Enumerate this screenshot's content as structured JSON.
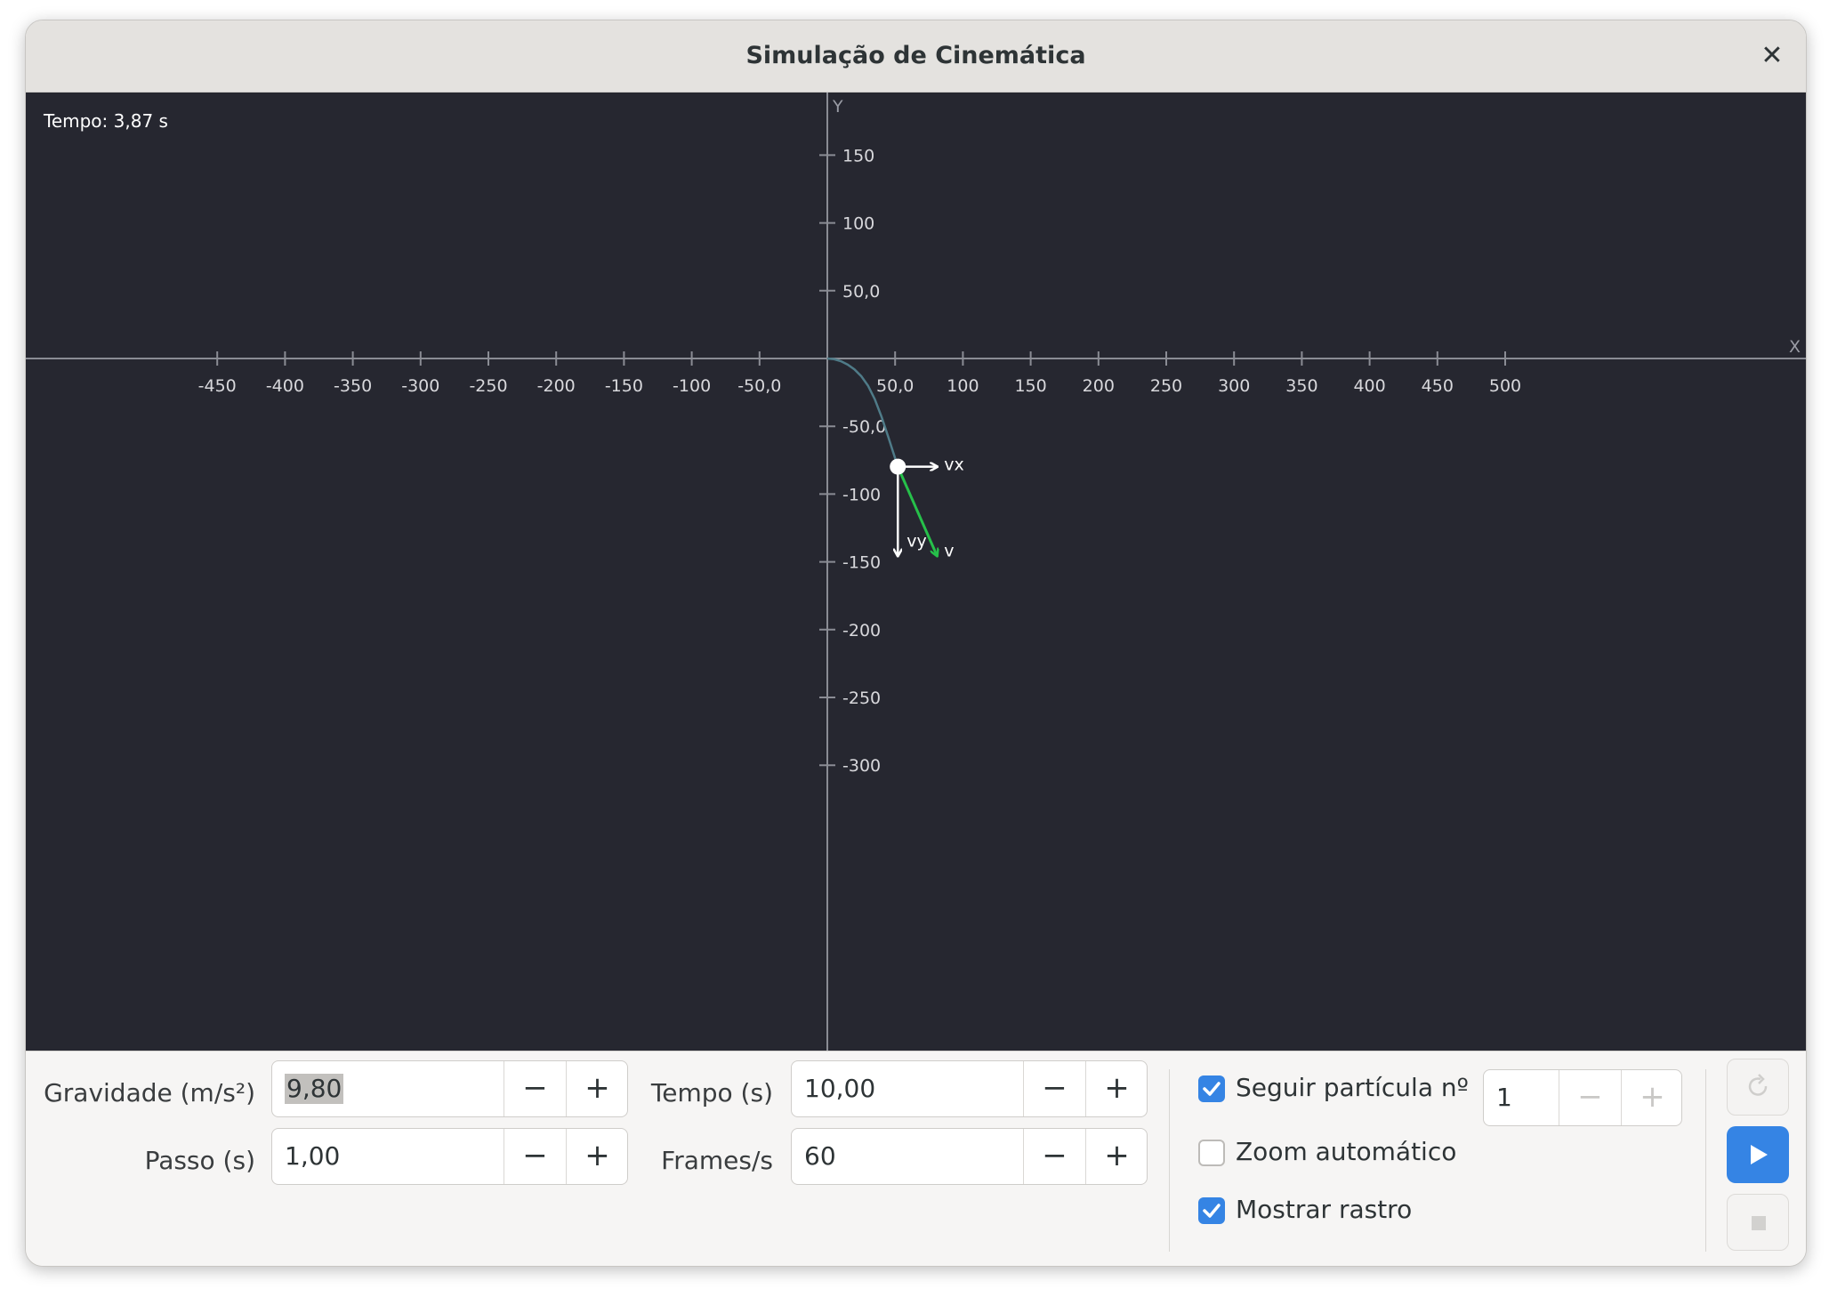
{
  "window": {
    "title": "Simulação de Cinemática"
  },
  "canvas": {
    "time_readout": "Tempo: 3,87 s",
    "axis_x_name": "X",
    "axis_y_name": "Y",
    "x_ticks": [
      "-450",
      "-400",
      "-350",
      "-300",
      "-250",
      "-200",
      "-150",
      "-100",
      "-50,0",
      "50,0",
      "100",
      "150",
      "200",
      "250",
      "300",
      "350",
      "400",
      "450",
      "500"
    ],
    "x_tick_values": [
      -450,
      -400,
      -350,
      -300,
      -250,
      -200,
      -150,
      -100,
      -50,
      50,
      100,
      150,
      200,
      250,
      300,
      350,
      400,
      450,
      500
    ],
    "y_ticks": [
      "150",
      "100",
      "50,0",
      "-50,0",
      "-100",
      "-150",
      "-200",
      "-250",
      "-300"
    ],
    "y_tick_values": [
      150,
      100,
      50,
      -50,
      -100,
      -150,
      -200,
      -250,
      -300
    ],
    "particle": {
      "x": 52,
      "y": -79.8,
      "vx_label": "vx",
      "vy_label": "vy",
      "v_label": "v"
    },
    "trail": [
      [
        0,
        0
      ],
      [
        5,
        -0.5
      ],
      [
        10,
        -2
      ],
      [
        15,
        -4.5
      ],
      [
        20,
        -8
      ],
      [
        25,
        -13
      ],
      [
        30,
        -20
      ],
      [
        35,
        -30
      ],
      [
        40,
        -43
      ],
      [
        45,
        -58
      ],
      [
        52,
        -79.8
      ]
    ],
    "colors": {
      "background": "#262730",
      "axis": "#8a8c94",
      "trail": "#4f7b88",
      "velocity": "#26c04a",
      "components": "#ffffff"
    }
  },
  "controls": {
    "gravity": {
      "label": "Gravidade (m/s²)",
      "value": "9,80"
    },
    "time": {
      "label": "Tempo (s)",
      "value": "10,00"
    },
    "step": {
      "label": "Passo (s)",
      "value": "1,00"
    },
    "fps": {
      "label": "Frames/s",
      "value": "60"
    },
    "minus": "−",
    "plus": "+",
    "follow": {
      "label": "Seguir partícula nº",
      "checked": true,
      "value": "1"
    },
    "autozoom": {
      "label": "Zoom automático",
      "checked": false
    },
    "trail": {
      "label": "Mostrar rastro",
      "checked": true
    }
  }
}
